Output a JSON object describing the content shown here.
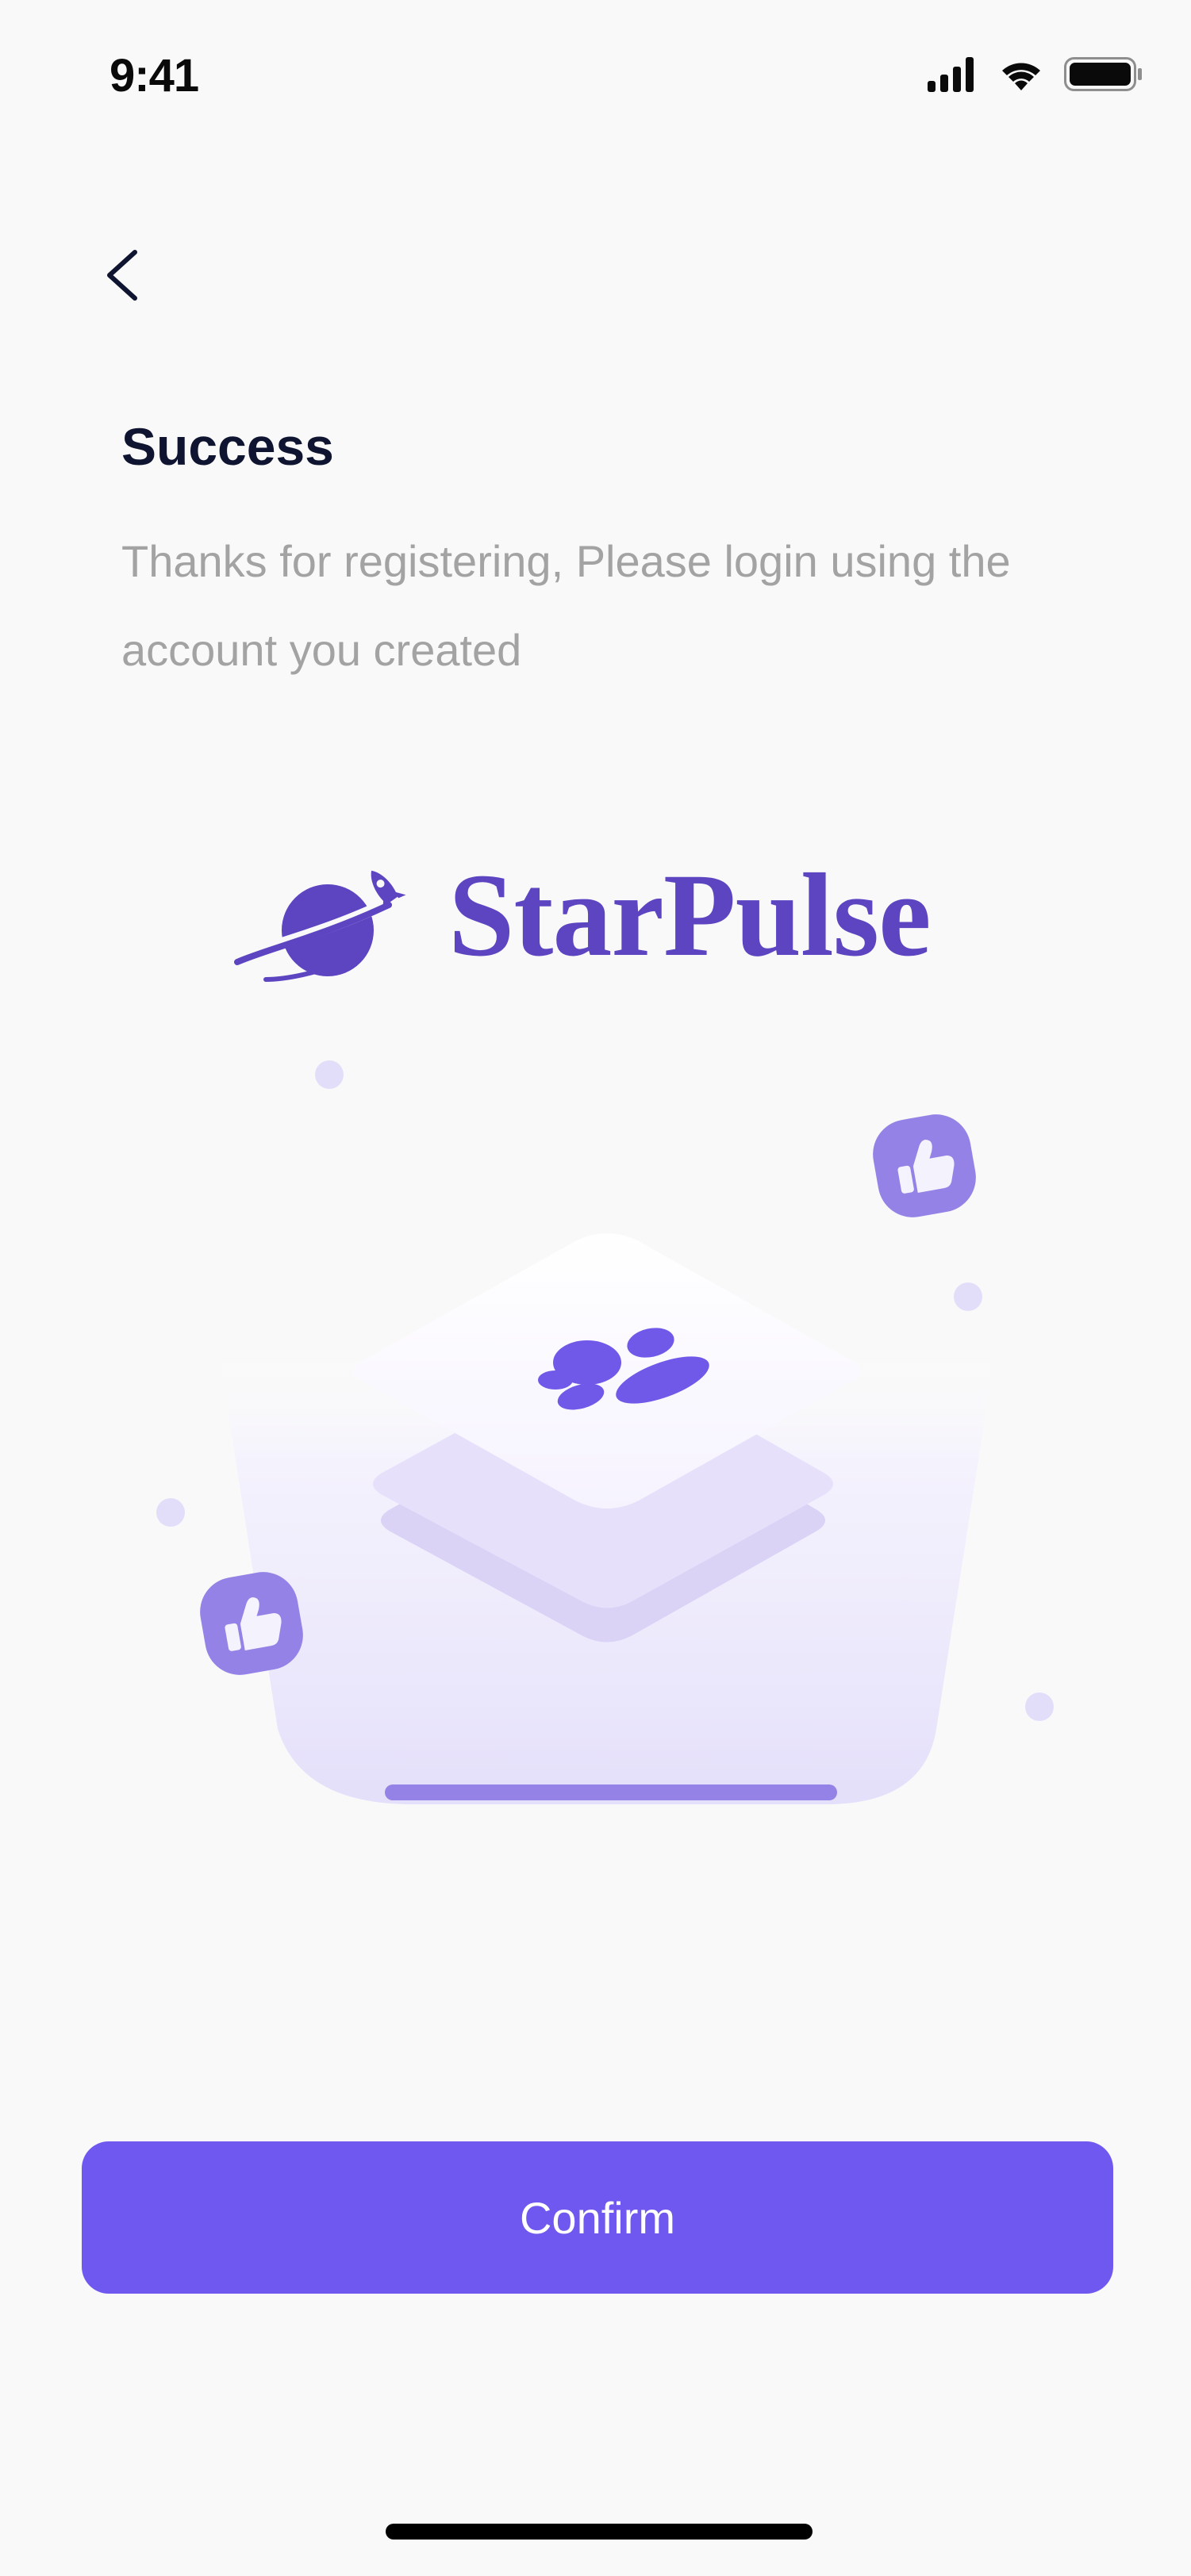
{
  "status_bar": {
    "time": "9:41",
    "icons": [
      "signal-icon",
      "wifi-icon",
      "battery-icon"
    ]
  },
  "nav": {
    "back_icon": "chevron-left-icon"
  },
  "content": {
    "title": "Success",
    "subtitle": "Thanks for registering, Please login using the account you created"
  },
  "brand": {
    "name": "StarPulse",
    "logo_icon": "planet-rocket-icon",
    "color": "#5d45c2"
  },
  "illustration": {
    "icons": [
      "thumbs-up-icon",
      "thumbs-up-icon",
      "people-icon"
    ]
  },
  "actions": {
    "confirm_label": "Confirm",
    "accent_color": "#6f58f0"
  }
}
